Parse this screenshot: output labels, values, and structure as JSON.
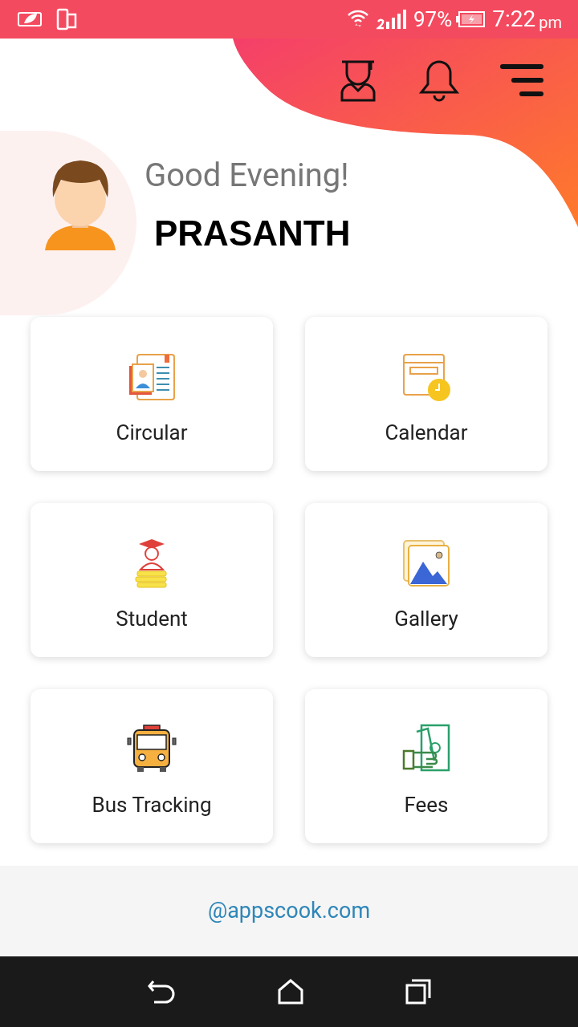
{
  "status_bar": {
    "battery": "97%",
    "time": "7:22",
    "time_suffix": "pm"
  },
  "greeting": "Good Evening!",
  "user_name": "PRASANTH",
  "menu": [
    {
      "label": "Circular",
      "kind": "circular"
    },
    {
      "label": "Calendar",
      "kind": "calendar"
    },
    {
      "label": "Student",
      "kind": "student"
    },
    {
      "label": "Gallery",
      "kind": "gallery"
    },
    {
      "label": "Bus Tracking",
      "kind": "bus"
    },
    {
      "label": "Fees",
      "kind": "fees"
    }
  ],
  "footer": {
    "link": "@appscook.com"
  }
}
